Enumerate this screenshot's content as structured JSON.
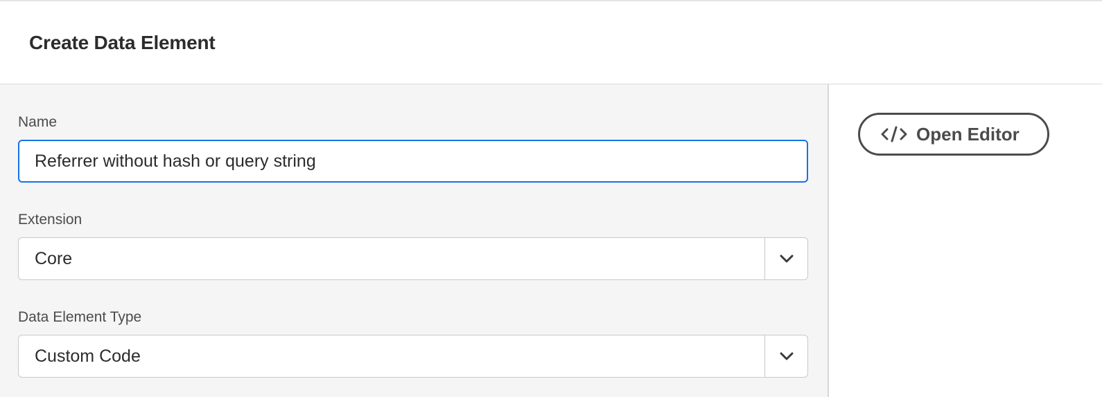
{
  "header": {
    "title": "Create Data Element"
  },
  "form": {
    "name": {
      "label": "Name",
      "value": "Referrer without hash or query string"
    },
    "extension": {
      "label": "Extension",
      "selected": "Core"
    },
    "data_element_type": {
      "label": "Data Element Type",
      "selected": "Custom Code"
    }
  },
  "editor": {
    "open_label": "Open Editor",
    "icon": "code-icon"
  },
  "colors": {
    "focus_border": "#1473e6",
    "left_panel_bg": "#f5f5f5",
    "text": "#2c2c2c",
    "button_border": "#4b4b4b"
  },
  "icons": {
    "dropdown": "chevron-down-icon"
  }
}
